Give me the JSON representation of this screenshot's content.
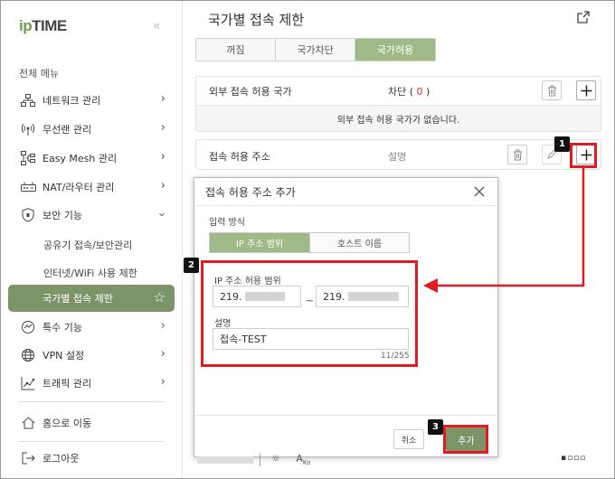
{
  "app": {
    "logo_ip": "ip",
    "logo_time": "TIME",
    "collapse": "«"
  },
  "sidebar": {
    "heading": "전체 메뉴",
    "items": [
      {
        "label": "네트워크 관리",
        "icon": "network-icon"
      },
      {
        "label": "무선랜 관리",
        "icon": "wireless-icon"
      },
      {
        "label": "Easy Mesh 관리",
        "icon": "mesh-icon"
      },
      {
        "label": "NAT/라우터 관리",
        "icon": "router-icon"
      },
      {
        "label": "보안 기능",
        "icon": "shield-icon"
      }
    ],
    "security_sub": [
      "공유기 접속/보안관리",
      "인터넷/WiFi 사용 제한"
    ],
    "active_item": "국가별 접속 제한",
    "items_after": [
      {
        "label": "특수 기능",
        "icon": "special-icon"
      },
      {
        "label": "VPN 설정",
        "icon": "vpn-icon"
      },
      {
        "label": "트래픽 관리",
        "icon": "traffic-icon"
      }
    ],
    "home": "홈으로 이동",
    "logout": "로그아웃"
  },
  "main": {
    "title": "국가별 접속 제한",
    "tabs": [
      {
        "label": "꺼짐",
        "active": false
      },
      {
        "label": "국가차단",
        "active": false
      },
      {
        "label": "국가허용",
        "active": true
      }
    ],
    "allowed_countries": {
      "label": "외부 접속 허용 국가",
      "status_prefix": "차단 ( ",
      "status_count": "0",
      "status_suffix": " )",
      "empty_message": "외부 접속 허용 국가가 없습니다."
    },
    "allowed_addresses": {
      "label": "접속 허용 주소",
      "desc_header": "설명"
    }
  },
  "modal": {
    "title": "접속 허용 주소 추가",
    "input_method_label": "입력 방식",
    "methods": [
      {
        "label": "IP 주소 범위",
        "active": true
      },
      {
        "label": "호스트 이름",
        "active": false
      }
    ],
    "ip_range_label": "IP 주소 허용 범위",
    "ip_start": "219.",
    "ip_end": "219.",
    "tilde": "~",
    "desc_label": "설명",
    "desc_value": "접속-TEST",
    "counter": "11/255",
    "cancel": "취소",
    "add": "추가"
  },
  "annotations": {
    "badge1": "1",
    "badge2": "2",
    "badge3": "3"
  },
  "colors": {
    "accent": "#7c9468",
    "tab_active": "#9fba86",
    "annotation_red": "#e01b24"
  }
}
